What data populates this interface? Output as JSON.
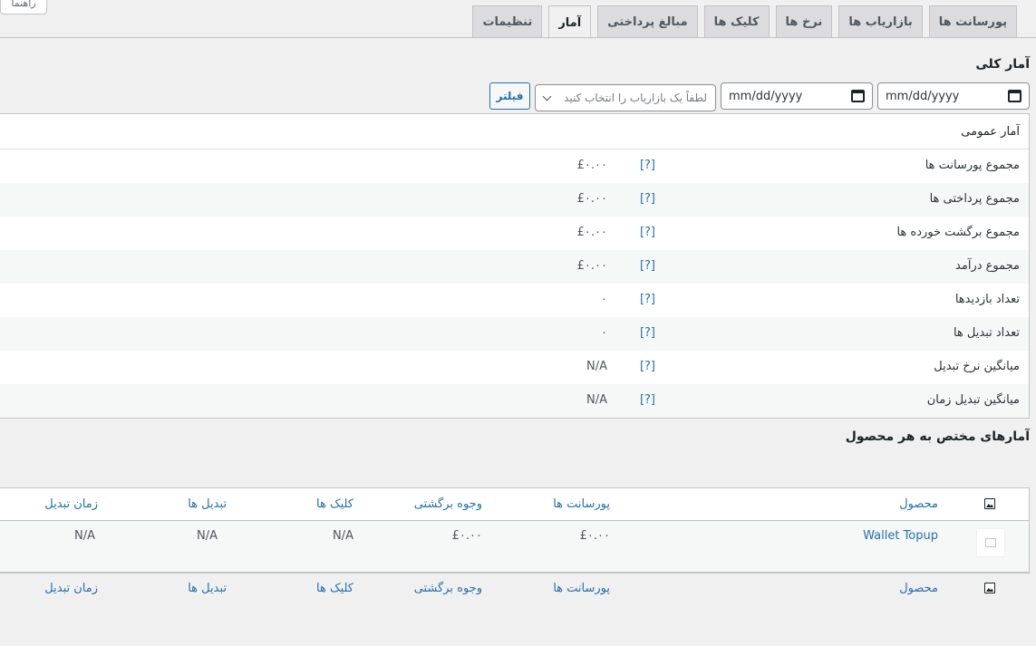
{
  "help_button": "راهنما",
  "tabs": [
    {
      "label": "پورسانت ها",
      "active": false
    },
    {
      "label": "بازاریاب ها",
      "active": false
    },
    {
      "label": "نرخ ها",
      "active": false
    },
    {
      "label": "کلیک ها",
      "active": false
    },
    {
      "label": "مبالغ پرداختی",
      "active": false
    },
    {
      "label": "آمار",
      "active": true
    },
    {
      "label": "تنظیمات",
      "active": false
    }
  ],
  "overview_title": "آمار کلی",
  "filter": {
    "date_from_placeholder": "mm/dd/yyyy",
    "date_to_placeholder": "mm/dd/yyyy",
    "affiliate_placeholder": "لطفاً یک بازاریاب را انتخاب کنید",
    "filter_button": "فیلتر"
  },
  "general_stats": {
    "heading": "آمار عمومی",
    "help_marker": "[?]",
    "rows": [
      {
        "label": "مجموع پورسانت ها",
        "value": "£۰.۰۰"
      },
      {
        "label": "مجموع پرداختی ها",
        "value": "£۰.۰۰"
      },
      {
        "label": "مجموع برگشت خورده ها",
        "value": "£۰.۰۰"
      },
      {
        "label": "مجموع درآمد",
        "value": "£۰.۰۰"
      },
      {
        "label": "تعداد بازدیدها",
        "value": "۰"
      },
      {
        "label": "تعداد تبدیل ها",
        "value": "۰"
      },
      {
        "label": "میانگین نرخ تبدیل",
        "value": "N/A"
      },
      {
        "label": "میانگین تبدیل زمان",
        "value": "N/A"
      }
    ]
  },
  "product_title": "آمارهای مختص به هر محصول",
  "product_table": {
    "columns": [
      "محصول",
      "پورسانت ها",
      "وجوه برگشتی",
      "کلیک ها",
      "تبدیل ها",
      "زمان تبدیل"
    ],
    "rows": [
      {
        "product": "Wallet Topup",
        "commissions": "£۰.۰۰",
        "refunds": "£۰.۰۰",
        "clicks": "N/A",
        "conversions": "N/A",
        "conversion_time": "N/A"
      }
    ]
  }
}
